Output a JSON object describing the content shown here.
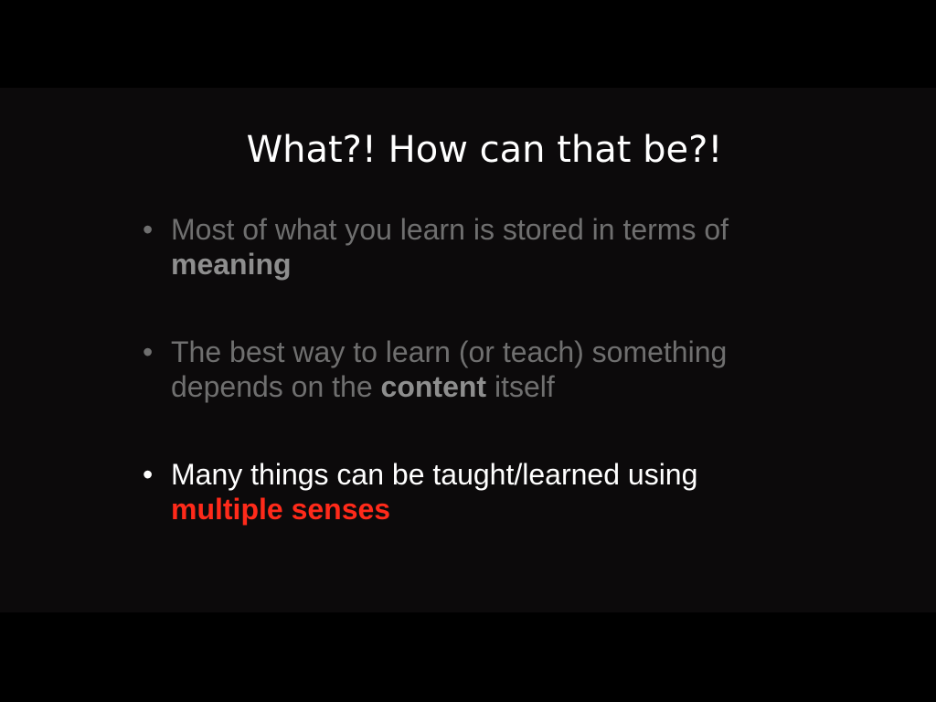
{
  "slide": {
    "title": "What?! How can that be?!",
    "bullets": [
      {
        "marker": "•",
        "text_before": "Most of what you learn is stored in terms of ",
        "emphasis": "meaning",
        "text_after": ""
      },
      {
        "marker": "•",
        "text_before": "The best way to learn (or teach) something depends on the ",
        "emphasis": "content",
        "text_after": " itself"
      },
      {
        "marker": "•",
        "text_before": "Many things can be taught/learned using ",
        "emphasis": "multiple senses",
        "text_after": ""
      }
    ]
  },
  "colors": {
    "background": "#0c0a0b",
    "title": "#ffffff",
    "dimmed_text": "#6f6f6f",
    "active_text": "#ffffff",
    "accent": "#ff2a1a"
  }
}
